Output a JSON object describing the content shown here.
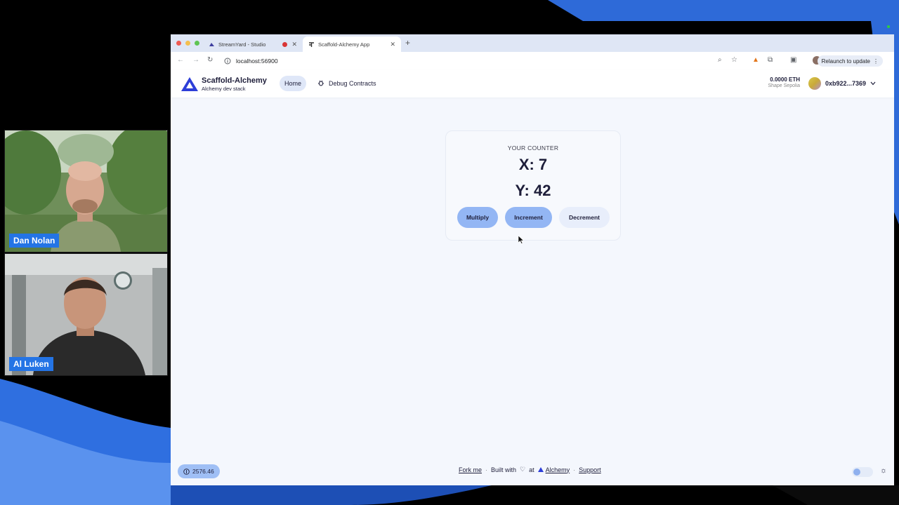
{
  "stream": {
    "participants": [
      {
        "name": "Dan Nolan"
      },
      {
        "name": "Al Luken"
      }
    ]
  },
  "browser": {
    "tabs": [
      {
        "title": "StreamYard - Studio",
        "favicon": "streamyard-icon"
      },
      {
        "title": "Scaffold-Alchemy App",
        "favicon": "scaffold-icon"
      }
    ],
    "url": "localhost:56900",
    "relaunch_label": "Relaunch to update"
  },
  "app": {
    "brand_title": "Scaffold-Alchemy",
    "brand_subtitle": "Alchemy dev stack",
    "nav": {
      "home": "Home",
      "debug": "Debug Contracts"
    },
    "wallet": {
      "balance": "0.0000 ETH",
      "network": "Shape Sepolia",
      "address": "0xb922...7369"
    },
    "counter": {
      "label": "YOUR COUNTER",
      "x": "X: 7",
      "y": "Y: 42",
      "buttons": {
        "multiply": "Multiply",
        "increment": "Increment",
        "decrement": "Decrement"
      }
    },
    "footer": {
      "price": "2576.46",
      "fork": "Fork me",
      "built_with": "Built with",
      "at": "at",
      "alchemy": "Alchemy",
      "support": "Support",
      "separator": "·"
    }
  },
  "colors": {
    "accent": "#93b6f4",
    "name_tag": "#2474e5",
    "brand": "#2d3ed8"
  }
}
